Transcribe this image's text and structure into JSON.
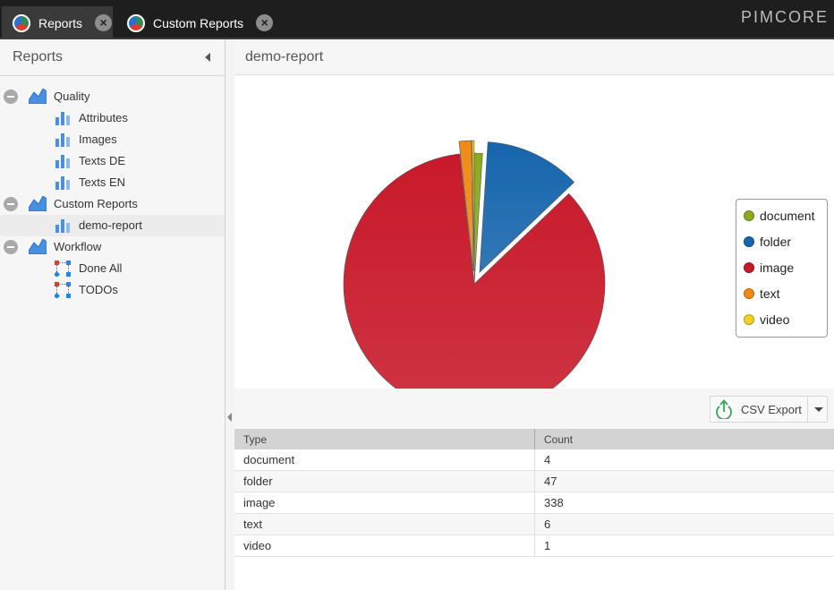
{
  "tabs": [
    {
      "label": "Reports",
      "icon": "pie-chart-icon",
      "active": true
    },
    {
      "label": "Custom Reports",
      "icon": "pie-chart-icon",
      "active": false
    }
  ],
  "brand": {
    "logo_text": "PIMCORE"
  },
  "left_panel": {
    "title": "Reports",
    "tree": [
      {
        "label": "Quality",
        "level": 1,
        "icon": "area-chart-icon",
        "expanded": true,
        "children": [
          {
            "label": "Attributes",
            "icon": "bar-chart-icon"
          },
          {
            "label": "Images",
            "icon": "bar-chart-icon"
          },
          {
            "label": "Texts DE",
            "icon": "bar-chart-icon"
          },
          {
            "label": "Texts EN",
            "icon": "bar-chart-icon"
          }
        ]
      },
      {
        "label": "Custom Reports",
        "level": 1,
        "icon": "area-chart-icon",
        "expanded": true,
        "children": [
          {
            "label": "demo-report",
            "icon": "bar-chart-icon",
            "selected": true
          }
        ]
      },
      {
        "label": "Workflow",
        "level": 1,
        "icon": "area-chart-icon",
        "expanded": true,
        "children": [
          {
            "label": "Done All",
            "icon": "workflow-icon"
          },
          {
            "label": "TODOs",
            "icon": "workflow-icon"
          }
        ]
      }
    ]
  },
  "report": {
    "title": "demo-report",
    "toolbar": {
      "csv_export_label": "CSV Export"
    },
    "grid": {
      "columns": [
        "Type",
        "Count"
      ],
      "rows": [
        {
          "type": "document",
          "count": "4"
        },
        {
          "type": "folder",
          "count": "47"
        },
        {
          "type": "image",
          "count": "338"
        },
        {
          "type": "text",
          "count": "6"
        },
        {
          "type": "video",
          "count": "1"
        }
      ]
    }
  },
  "chart_data": {
    "type": "pie",
    "categories": [
      "document",
      "folder",
      "image",
      "text",
      "video"
    ],
    "values": [
      4,
      47,
      338,
      6,
      1
    ],
    "colors": [
      "#8bab1e",
      "#1665ad",
      "#c8192a",
      "#f08a16",
      "#f2cf22"
    ],
    "exploded": [
      false,
      true,
      false,
      true,
      true
    ],
    "legend_position": "right"
  },
  "colors": {
    "topbar": "#1e1e1e",
    "accent_blue": "#4a90e2"
  }
}
